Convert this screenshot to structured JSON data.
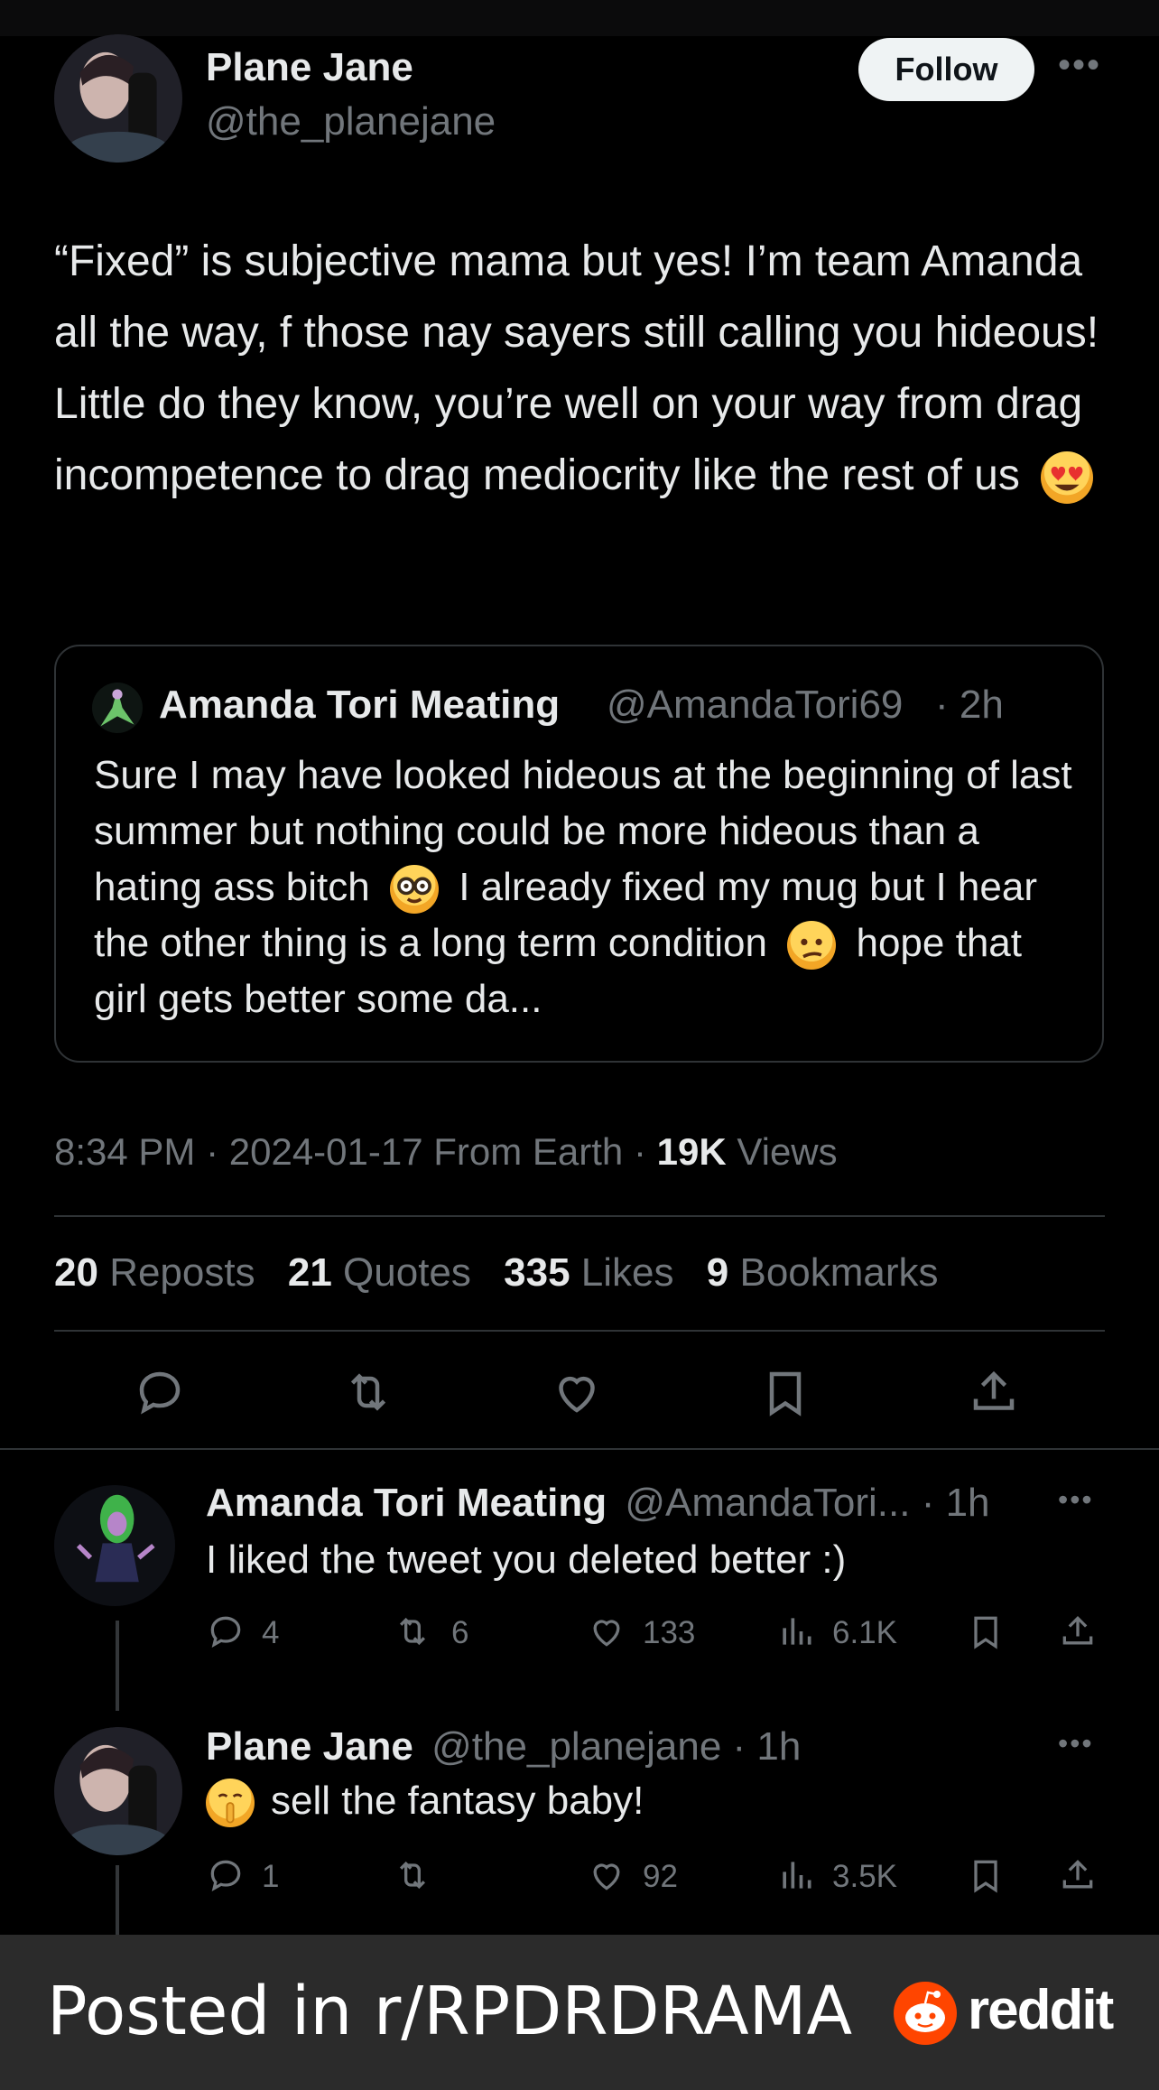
{
  "author": {
    "name": "Plane Jane",
    "handle": "@the_planejane",
    "follow_label": "Follow"
  },
  "post": {
    "text": "“Fixed” is subjective mama but yes! I’m team Amanda all the way, f those nay sayers still calling you hideous! Little do they know, you’re well on your way from drag incompetence to drag mediocrity like the rest of us",
    "emoji": "heart-eyes"
  },
  "quoted": {
    "name": "Amanda Tori Meating",
    "handle": "@AmandaTori69",
    "time": "· 2h",
    "text_1": "Sure I may have looked hideous at the beginning of last summer but nothing could be more hideous than a hating ass bitch",
    "text_2": "I already fixed my mug but I hear the other thing is a long term condition",
    "text_3": "hope that girl gets better some da..."
  },
  "meta": {
    "time": "8:34 PM · 2024-01-17 From Earth ·",
    "views_count": "19K",
    "views_label": "Views"
  },
  "stats": {
    "reposts_count": "20",
    "reposts_label": "Reposts",
    "quotes_count": "21",
    "quotes_label": "Quotes",
    "likes_count": "335",
    "likes_label": "Likes",
    "bookmarks_count": "9",
    "bookmarks_label": "Bookmarks"
  },
  "replies": [
    {
      "name": "Amanda Tori Meating",
      "handle": "@AmandaTori...",
      "time": "· 1h",
      "text": "I liked the tweet you deleted better :)",
      "replies": "4",
      "reposts": "6",
      "likes": "133",
      "views": "6.1K"
    },
    {
      "name": "Plane Jane",
      "handle": "@the_planejane",
      "time": "· 1h",
      "text": "sell the fantasy baby!",
      "emoji": "shushing-face",
      "replies": "1",
      "reposts": "",
      "likes": "92",
      "views": "3.5K"
    }
  ],
  "footer": {
    "posted_in": "Posted in r/RPDRDRAMA",
    "brand": "reddit"
  },
  "colors": {
    "background": "#000000",
    "text": "#e7e9ea",
    "muted": "#71767b",
    "divider": "#2f3336",
    "follow_bg": "#eff3f4",
    "footer_bg": "#2b2b2b",
    "reddit_orange": "#ff4500"
  }
}
